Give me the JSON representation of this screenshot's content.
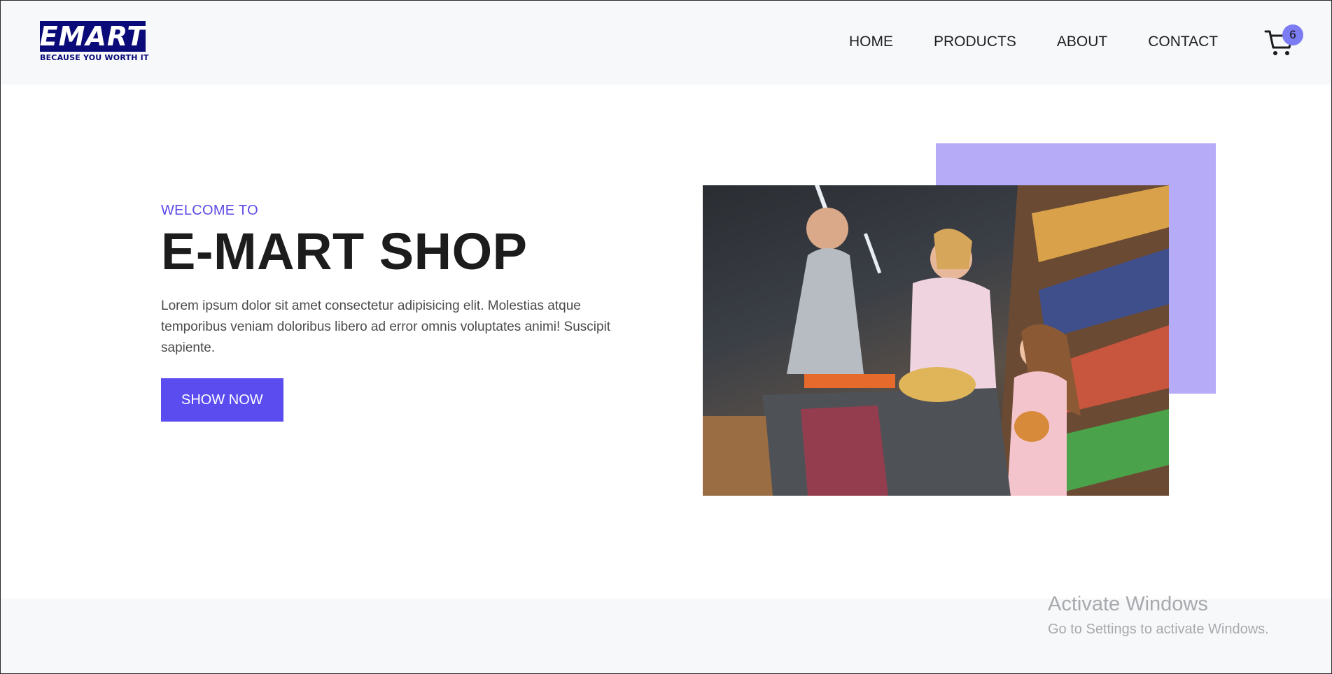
{
  "header": {
    "logo_text": "EMART",
    "logo_tagline": "BECAUSE YOU WORTH IT",
    "nav": [
      {
        "label": "HOME"
      },
      {
        "label": "PRODUCTS"
      },
      {
        "label": "ABOUT"
      },
      {
        "label": "CONTACT"
      }
    ],
    "cart_count": "6"
  },
  "hero": {
    "eyebrow": "WELCOME TO",
    "title": "E-MART SHOP",
    "description": "Lorem ipsum dolor sit amet consectetur adipisicing elit. Molestias atque temporibus veniam doloribus libero ad error omnis voluptates animi! Suscipit sapiente.",
    "cta_label": "SHOW NOW"
  },
  "windows_watermark": {
    "heading": "Activate Windows",
    "subtext": "Go to Settings to activate Windows."
  },
  "colors": {
    "accent": "#5b4cf0",
    "logo_navy": "#0a0a78",
    "accent_block": "#b5abf6",
    "badge": "#7b7bf2"
  },
  "icons": [
    "cart-icon"
  ]
}
